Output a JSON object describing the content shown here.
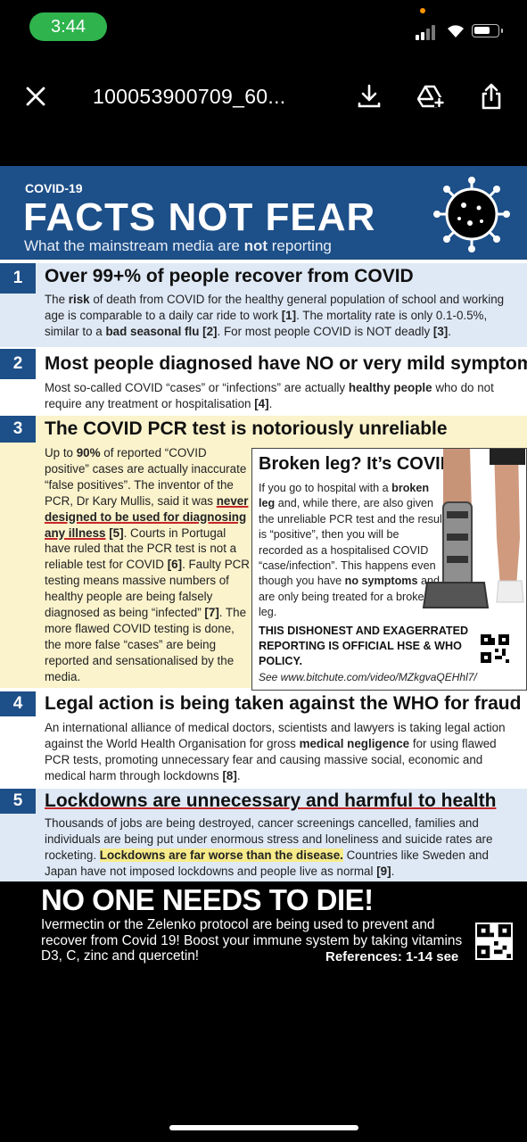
{
  "status": {
    "time": "3:44"
  },
  "toolbar": {
    "title": "100053900709_60..."
  },
  "poster": {
    "tag": "COVID-19",
    "title": "FACTS NOT FEAR",
    "subtitle_pre": "What the mainstream media are ",
    "subtitle_bold": "not",
    "subtitle_post": " reporting",
    "s1": {
      "num": "1",
      "head": "Over 99+% of people recover from COVID",
      "t1": "The ",
      "b1": "risk",
      "t2": " of death from COVID for the healthy general population of school and working age is comparable to a daily car ride to work ",
      "r1": "[1]",
      "t3": ". The mortality rate is only 0.1-0.5%, similar to a ",
      "b2": "bad seasonal flu",
      "t4": " ",
      "r2": "[2]",
      "t5": ". For most people COVID is NOT deadly ",
      "r3": "[3]",
      "t6": "."
    },
    "s2": {
      "num": "2",
      "head": "Most people diagnosed have NO or very mild symptoms",
      "t1": "Most so-called COVID “cases” or “infections” are actually ",
      "b1": "healthy people",
      "t2": " who do not require any treatment or hospitalisation ",
      "r1": "[4]",
      "t3": "."
    },
    "s3": {
      "num": "3",
      "head": "The COVID PCR test is notoriously unreliable",
      "t1": "Up to ",
      "b1": "90%",
      "t2": " of reported “COVID positive” cases are actually inaccurate “false positives”. The inventor of the PCR, Dr Kary Mullis, said it was ",
      "u1": "never designed to be used for diagnosing any illness",
      "t3": " ",
      "r1": "[5]",
      "t4": ". Courts in Portugal have ruled that the PCR test is not a reliable test for COVID ",
      "r2": "[6]",
      "t5": ". Faulty PCR testing means massive numbers of healthy people are being falsely diagnosed as being “infected” ",
      "r3": "[7]",
      "t6": ". The more flawed COVID testing is done, the more false “cases” are being reported and sensationalised by the media."
    },
    "broken": {
      "title": "Broken leg? It’s COVID!",
      "t1": "If you go to hospital with a ",
      "b1": "broken leg",
      "t2": " and, while there, are also given the unreliable PCR test and the result is “positive”, then you will be recorded as a hospitalised COVID “case/infection”. This happens even though you have ",
      "b2": "no symptoms",
      "t3": " and are only being treated for a broken leg.",
      "policy": "THIS DISHONEST AND EXAGERRATED REPORTING IS OFFICIAL HSE & WHO POLICY.",
      "link": "See www.bitchute.com/video/MZkgvaQEHhl7/"
    },
    "s4": {
      "num": "4",
      "head": "Legal action is being taken against the WHO for fraud",
      "t1": "An international alliance of medical doctors, scientists and lawyers is taking legal action against the World Health Organisation for gross ",
      "b1": "medical negligence",
      "t2": " for using flawed PCR tests, promoting unnecessary fear and causing massive social, economic and medical harm through lockdowns ",
      "r1": "[8]",
      "t3": "."
    },
    "s5": {
      "num": "5",
      "head": "Lockdowns are unnecessary and harmful to health",
      "t1": "Thousands of jobs are being destroyed, cancer screenings cancelled, families and individuals are being put under enormous stress and loneliness and suicide rates are rocketing. ",
      "h1": "Lockdowns are far worse than the disease.",
      "t2": " Countries like Sweden and Japan have not imposed lockdowns and people live as normal ",
      "r1": "[9]",
      "t3": "."
    },
    "footer": {
      "title": "NO ONE NEEDS TO DIE!",
      "body": "Ivermectin or the Zelenko protocol are being used to prevent and recover from Covid 19! Boost your immune system by taking vitamins D3, C, zinc and quercetin!",
      "refs": "References: 1-14 see"
    }
  }
}
